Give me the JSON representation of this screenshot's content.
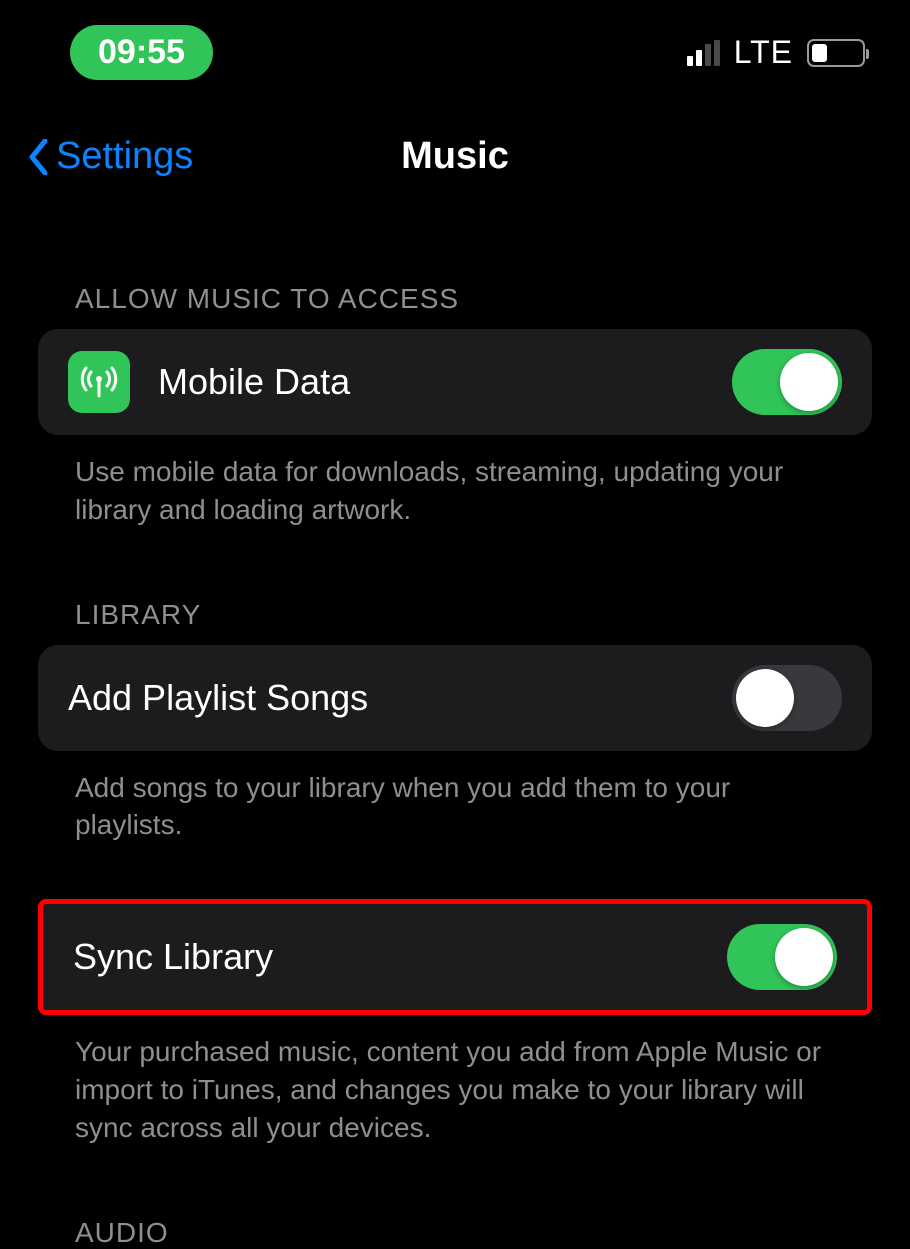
{
  "statusBar": {
    "time": "09:55",
    "network": "LTE"
  },
  "nav": {
    "back": "Settings",
    "title": "Music"
  },
  "sections": {
    "access": {
      "header": "ALLOW MUSIC TO ACCESS",
      "mobileData": {
        "label": "Mobile Data",
        "on": true,
        "footer": "Use mobile data for downloads, streaming, updating your library and loading artwork."
      }
    },
    "library": {
      "header": "LIBRARY",
      "addPlaylistSongs": {
        "label": "Add Playlist Songs",
        "on": false,
        "footer": "Add songs to your library when you add them to your playlists."
      },
      "syncLibrary": {
        "label": "Sync Library",
        "on": true,
        "footer": "Your purchased music, content you add from Apple Music or import to iTunes, and changes you make to your library will sync across all your devices."
      }
    },
    "audio": {
      "header": "AUDIO"
    }
  }
}
